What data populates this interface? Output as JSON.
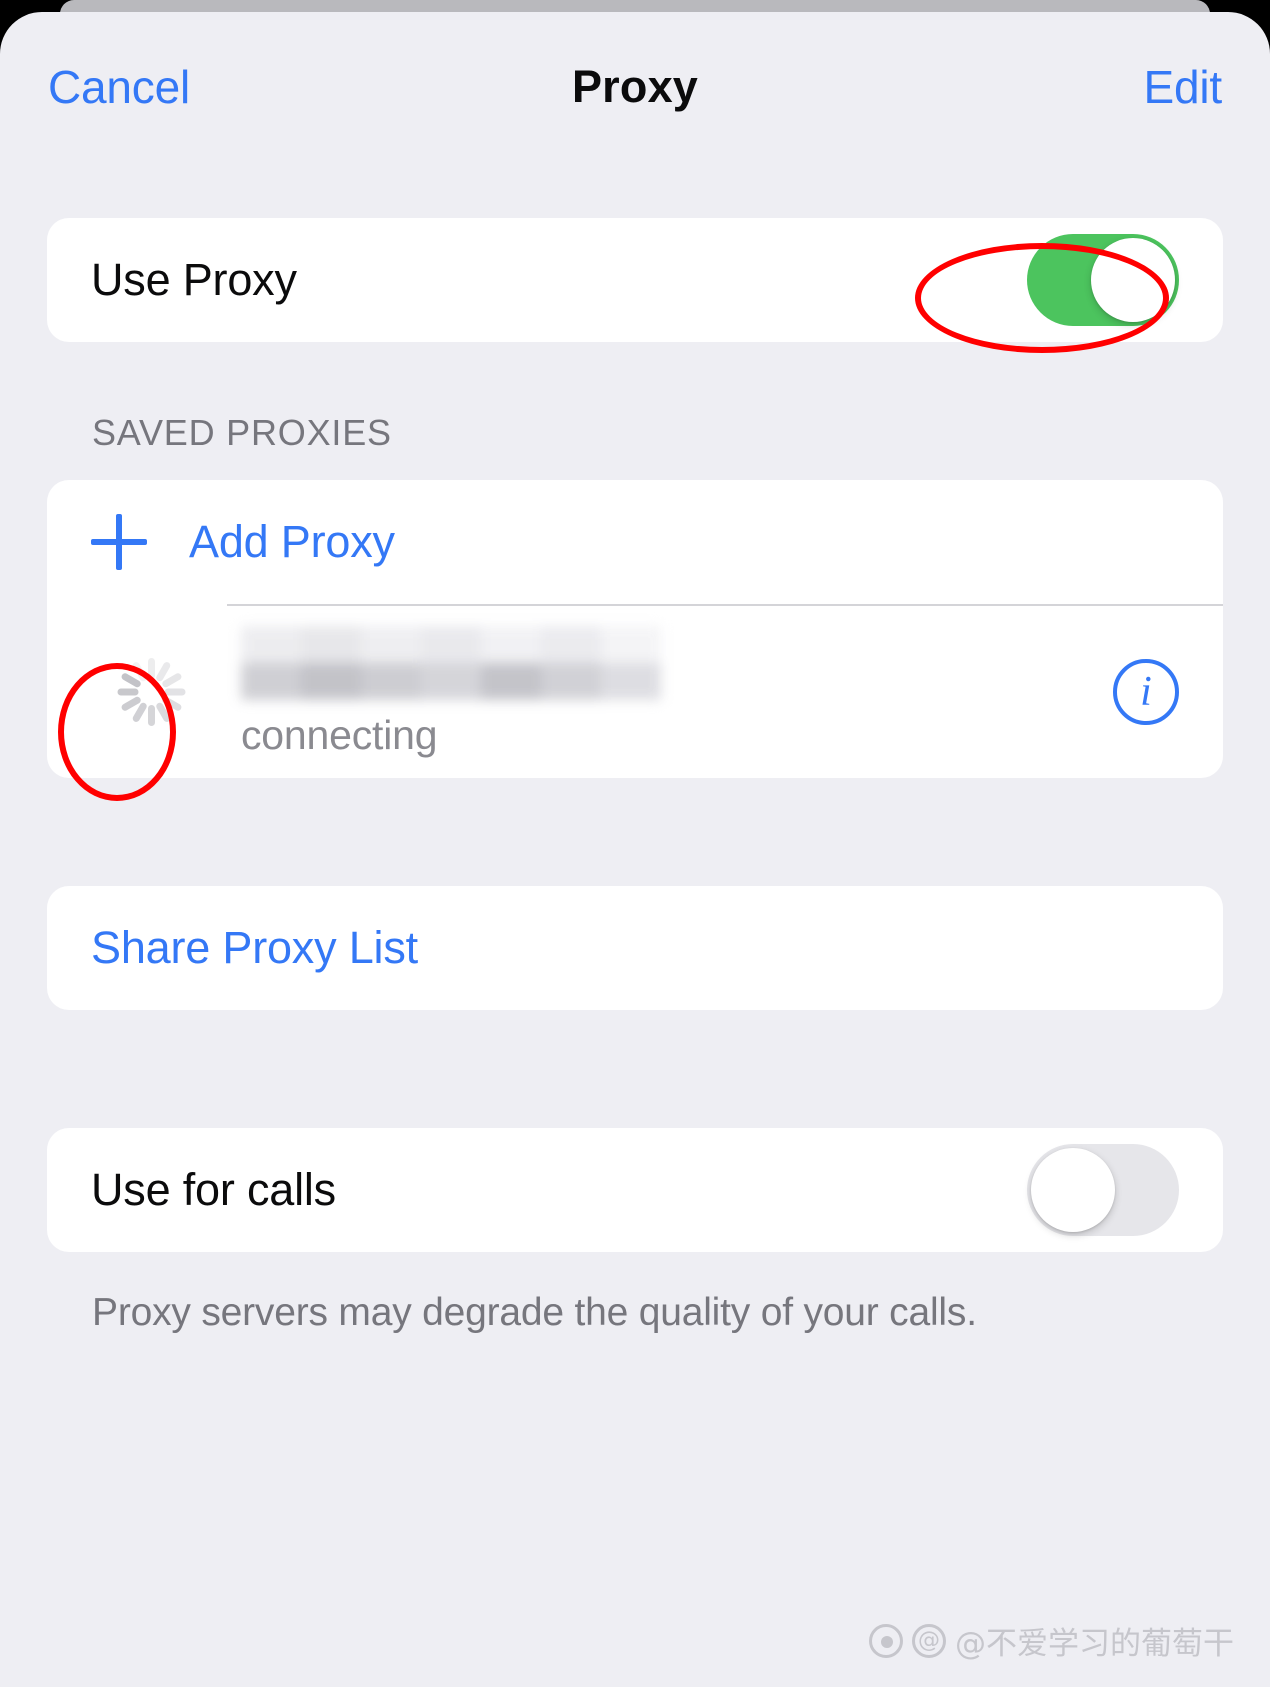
{
  "navbar": {
    "cancel_label": "Cancel",
    "title": "Proxy",
    "edit_label": "Edit"
  },
  "use_proxy": {
    "label": "Use Proxy",
    "toggle_state": "on"
  },
  "saved_proxies": {
    "section_header": "SAVED PROXIES",
    "add_label": "Add Proxy",
    "entry": {
      "name": "",
      "name_censored": true,
      "status": "connecting",
      "info_icon_label": "i"
    }
  },
  "share": {
    "label": "Share Proxy List"
  },
  "use_for_calls": {
    "label": "Use for calls",
    "toggle_state": "off",
    "footer_note": "Proxy servers may degrade the quality of your calls."
  },
  "annotations": {
    "color": "#ff0000",
    "targets": [
      "use-proxy-toggle",
      "proxy-status-spinner"
    ]
  },
  "watermark": {
    "text": "@不爱学习的葡萄干"
  },
  "colors": {
    "accent_blue": "#3478f6",
    "toggle_on_green": "#4cc45e",
    "toggle_off_gray": "#e6e6ea",
    "page_background": "#eeeef3",
    "card_background": "#ffffff",
    "secondary_text": "#76767d",
    "annotation_red": "#ff0000"
  }
}
